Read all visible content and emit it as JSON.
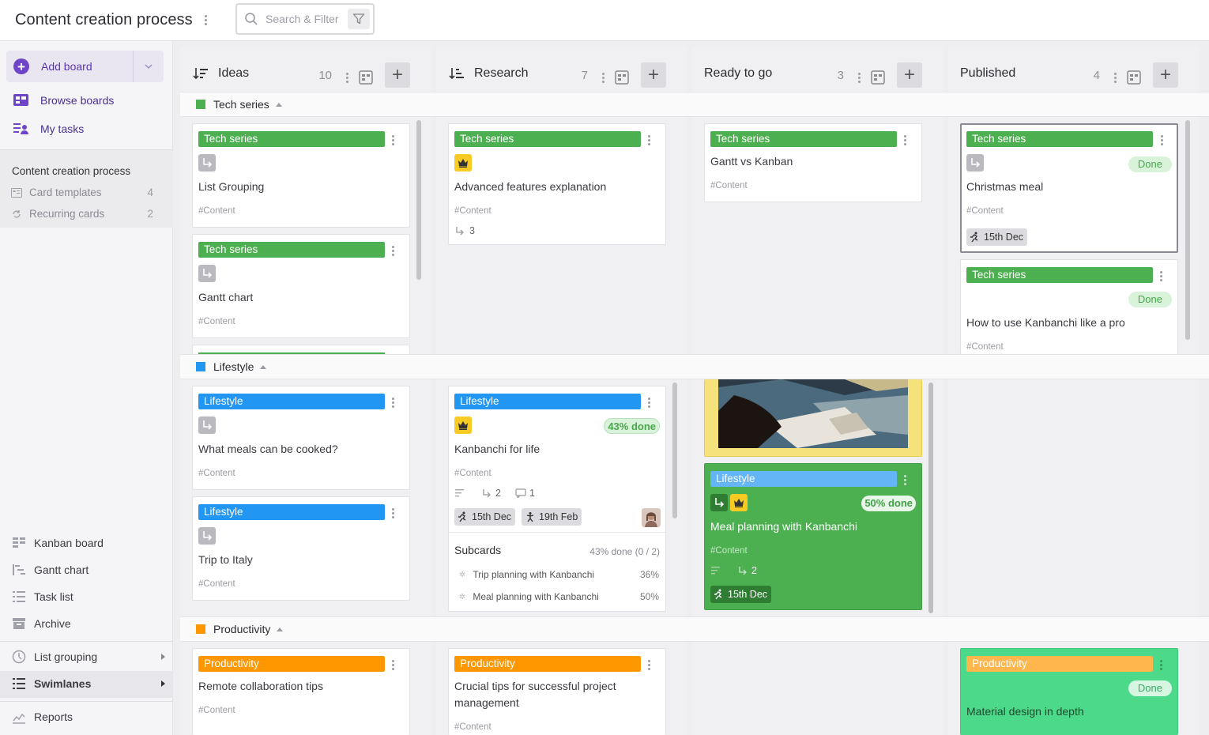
{
  "topbar": {
    "board_title": "Content creation process",
    "search_placeholder": "Search & Filter"
  },
  "sidebar": {
    "add_board_label": "Add board",
    "browse_boards_label": "Browse boards",
    "my_tasks_label": "My tasks",
    "board_section": {
      "title": "Content creation process",
      "rows": [
        {
          "label": "Card templates",
          "count": "4"
        },
        {
          "label": "Recurring cards",
          "count": "2"
        }
      ]
    },
    "views": [
      {
        "label": "Kanban board"
      },
      {
        "label": "Gantt chart"
      },
      {
        "label": "Task list"
      },
      {
        "label": "Archive"
      }
    ],
    "list_grouping_label": "List grouping",
    "swimlanes_label": "Swimlanes",
    "reports_label": "Reports"
  },
  "columns": [
    {
      "title": "Ideas",
      "count": "10"
    },
    {
      "title": "Research",
      "count": "7"
    },
    {
      "title": "Ready to go",
      "count": "3"
    },
    {
      "title": "Published",
      "count": "4"
    }
  ],
  "lanes": [
    {
      "name": "Tech series",
      "color": "#4caf50"
    },
    {
      "name": "Lifestyle",
      "color": "#2196f3"
    },
    {
      "name": "Productivity",
      "color": "#ff9800"
    }
  ],
  "colors": {
    "tech": "#4caf50",
    "lifestyle": "#2196f3",
    "productivity": "#ff9800",
    "accent": "#6e45c9",
    "highlight_card": "#4caf50",
    "published_card": "#4cd98a"
  },
  "cards": {
    "ideas_tech_1": {
      "tag": "Tech series",
      "title": "List Grouping",
      "hashtag": "#Content"
    },
    "ideas_tech_2": {
      "tag": "Tech series",
      "title": "Gantt chart",
      "hashtag": "#Content"
    },
    "research_tech_1": {
      "tag": "Tech series",
      "title": "Advanced features explanation",
      "hashtag": "#Content",
      "subcards": "3"
    },
    "ready_tech_1": {
      "tag": "Tech series",
      "title": "Gantt vs Kanban",
      "hashtag": "#Content"
    },
    "published_tech_1": {
      "tag": "Tech series",
      "status": "Done",
      "title": "Christmas meal",
      "hashtag": "#Content",
      "date": "15th Dec"
    },
    "published_tech_2": {
      "tag": "Tech series",
      "status": "Done",
      "title": "How to use Kanbanchi like a pro",
      "hashtag": "#Content"
    },
    "ideas_life_1": {
      "tag": "Lifestyle",
      "title": "What meals can be cooked?",
      "hashtag": "#Content"
    },
    "ideas_life_2": {
      "tag": "Lifestyle",
      "title": "Trip to Italy",
      "hashtag": "#Content"
    },
    "research_life_1": {
      "tag": "Lifestyle",
      "progress": "43% done",
      "title": "Kanbanchi for life",
      "hashtag": "#Content",
      "subcards": "2",
      "comments": "1",
      "start_date": "15th Dec",
      "due_date": "19th Feb",
      "subcards_title": "Subcards",
      "subcards_summary": "43% done (0 / 2)",
      "subcard_items": [
        {
          "name": "Trip planning with Kanbanchi",
          "pct": "36%"
        },
        {
          "name": "Meal planning with Kanbanchi",
          "pct": "50%"
        }
      ]
    },
    "ready_life_1": {
      "tag": "Lifestyle",
      "progress": "50% done",
      "title": "Meal planning with Kanbanchi",
      "hashtag": "#Content",
      "subcards": "2",
      "date": "15th Dec"
    },
    "ideas_prod_1": {
      "tag": "Productivity",
      "title": "Remote collaboration tips",
      "hashtag": "#Content"
    },
    "research_prod_1": {
      "tag": "Productivity",
      "title": "Crucial tips for successful project management",
      "hashtag": "#Content"
    },
    "published_prod_1": {
      "tag": "Productivity",
      "status": "Done",
      "title": "Material design in depth"
    }
  }
}
